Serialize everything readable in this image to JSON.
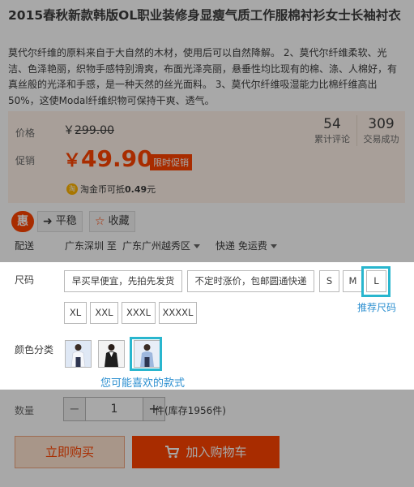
{
  "product": {
    "title": "2015春秋新款韩版OL职业装修身显瘦气质工作服棉衬衫女士长袖衬衣",
    "description": "莫代尔纤维的原料来自于大自然的木材，使用后可以自然降解。 2、莫代尔纤维柔软、光洁、色泽艳丽，织物手感特别滑爽，布面光泽亮丽，悬垂性均比现有的棉、涤、人棉好，有真丝般的光泽和手感，是一种天然的丝光面料。 3、莫代尔纤维吸湿能力比棉纤维高出50%，这使Modal纤维织物可保持干爽、透气。"
  },
  "price": {
    "label": "价格",
    "currency": "￥",
    "original": "299.00",
    "promo_label": "促销",
    "promo_value": "49.90",
    "promo_tag": "限时促销"
  },
  "stats": [
    {
      "value": "54",
      "label": "累计评论"
    },
    {
      "value": "309",
      "label": "交易成功"
    }
  ],
  "coin": {
    "icon_text": "淘",
    "text": "淘金币可抵",
    "amount": "0.49",
    "unit": "元"
  },
  "actions": {
    "hui": "惠",
    "ping": "平稳",
    "favorite": "收藏"
  },
  "shipping": {
    "label": "配送",
    "from": "广东深圳 至",
    "to": "广东广州越秀区",
    "method": "快递 免运费"
  },
  "size": {
    "label": "尺码",
    "options": [
      "早买早便宜，先拍先发货",
      "不定时涨价，包邮圆通快递",
      "S",
      "M",
      "L",
      "XL",
      "XXL",
      "XXXL",
      "XXXXL"
    ],
    "recommend_note": "推荐尺码"
  },
  "color": {
    "label": "颜色分类",
    "note": "您可能喜欢的款式"
  },
  "quantity": {
    "label": "数量",
    "minus": "−",
    "plus": "+",
    "value": "1",
    "stock": "件(库存1956件)"
  },
  "buttons": {
    "buy_now": "立即购买",
    "add_cart": "加入购物车"
  },
  "colors": {
    "accent": "#ff4400",
    "highlight": "#29b6ce",
    "note_blue": "#2c8fd0"
  }
}
